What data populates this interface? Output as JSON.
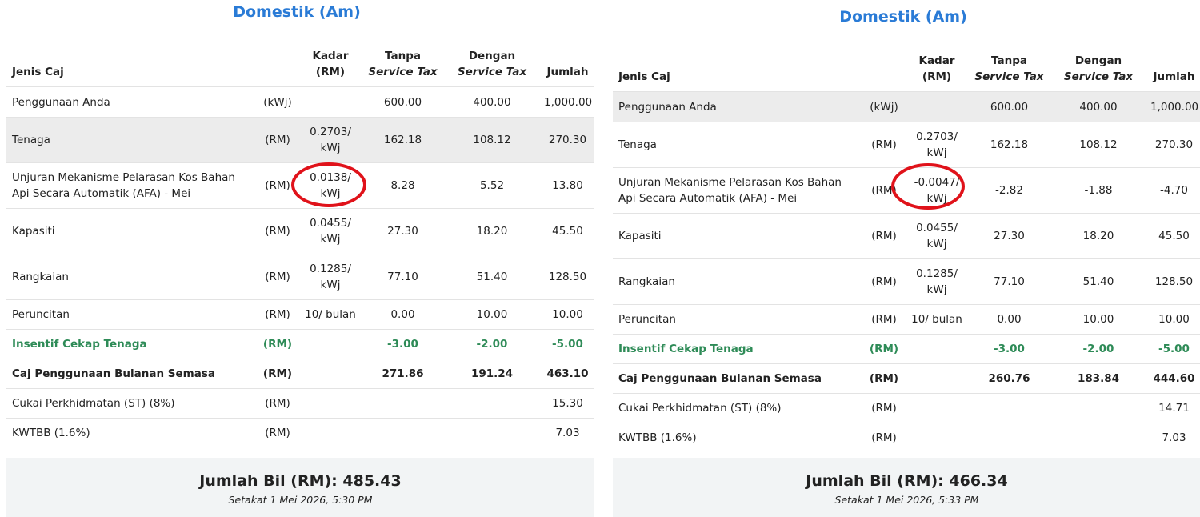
{
  "left": {
    "title": "Domestik (Am)",
    "headers": {
      "name": "Jenis Caj",
      "rate_l1": "Kadar",
      "rate_l2": "(RM)",
      "without_l1": "Tanpa",
      "without_l2": "Service Tax",
      "with_l1": "Dengan",
      "with_l2": "Service Tax",
      "total": "Jumlah"
    },
    "rows": [
      {
        "name": "Penggunaan Anda",
        "unit": "(kWj)",
        "rate": "",
        "without": "600.00",
        "with": "400.00",
        "total": "1,000.00"
      },
      {
        "name": "Tenaga",
        "unit": "(RM)",
        "rate": "0.2703/ kWj",
        "without": "162.18",
        "with": "108.12",
        "total": "270.30"
      },
      {
        "name": "Unjuran Mekanisme Pelarasan Kos Bahan Api Secara Automatik (AFA) - Mei",
        "unit": "(RM)",
        "rate": "0.0138/ kWj",
        "without": "8.28",
        "with": "5.52",
        "total": "13.80"
      },
      {
        "name": "Kapasiti",
        "unit": "(RM)",
        "rate": "0.0455/ kWj",
        "without": "27.30",
        "with": "18.20",
        "total": "45.50"
      },
      {
        "name": "Rangkaian",
        "unit": "(RM)",
        "rate": "0.1285/ kWj",
        "without": "77.10",
        "with": "51.40",
        "total": "128.50"
      },
      {
        "name": "Peruncitan",
        "unit": "(RM)",
        "rate": "10/ bulan",
        "without": "0.00",
        "with": "10.00",
        "total": "10.00"
      },
      {
        "name": "Insentif Cekap Tenaga",
        "unit": "(RM)",
        "rate": "",
        "without": "-3.00",
        "with": "-2.00",
        "total": "-5.00"
      },
      {
        "name": "Caj Penggunaan Bulanan Semasa",
        "unit": "(RM)",
        "rate": "",
        "without": "271.86",
        "with": "191.24",
        "total": "463.10"
      },
      {
        "name": "Cukai Perkhidmatan (ST) (8%)",
        "unit": "(RM)",
        "rate": "",
        "without": "",
        "with": "",
        "total": "15.30"
      },
      {
        "name": "KWTBB (1.6%)",
        "unit": "(RM)",
        "rate": "",
        "without": "",
        "with": "",
        "total": "7.03"
      }
    ],
    "bill_total": "Jumlah Bil (RM): 485.43",
    "timestamp": "Setakat 1 Mei 2026, 5:30 PM"
  },
  "right": {
    "title": "Domestik (Am)",
    "headers": {
      "name": "Jenis Caj",
      "rate_l1": "Kadar",
      "rate_l2": "(RM)",
      "without_l1": "Tanpa",
      "without_l2": "Service Tax",
      "with_l1": "Dengan",
      "with_l2": "Service Tax",
      "total": "Jumlah"
    },
    "rows": [
      {
        "name": "Penggunaan Anda",
        "unit": "(kWj)",
        "rate": "",
        "without": "600.00",
        "with": "400.00",
        "total": "1,000.00"
      },
      {
        "name": "Tenaga",
        "unit": "(RM)",
        "rate": "0.2703/ kWj",
        "without": "162.18",
        "with": "108.12",
        "total": "270.30"
      },
      {
        "name": "Unjuran Mekanisme Pelarasan Kos Bahan Api Secara Automatik (AFA) - Mei",
        "unit": "(RM)",
        "rate": "-0.0047/ kWj",
        "without": "-2.82",
        "with": "-1.88",
        "total": "-4.70"
      },
      {
        "name": "Kapasiti",
        "unit": "(RM)",
        "rate": "0.0455/ kWj",
        "without": "27.30",
        "with": "18.20",
        "total": "45.50"
      },
      {
        "name": "Rangkaian",
        "unit": "(RM)",
        "rate": "0.1285/ kWj",
        "without": "77.10",
        "with": "51.40",
        "total": "128.50"
      },
      {
        "name": "Peruncitan",
        "unit": "(RM)",
        "rate": "10/ bulan",
        "without": "0.00",
        "with": "10.00",
        "total": "10.00"
      },
      {
        "name": "Insentif Cekap Tenaga",
        "unit": "(RM)",
        "rate": "",
        "without": "-3.00",
        "with": "-2.00",
        "total": "-5.00"
      },
      {
        "name": "Caj Penggunaan Bulanan Semasa",
        "unit": "(RM)",
        "rate": "",
        "without": "260.76",
        "with": "183.84",
        "total": "444.60"
      },
      {
        "name": "Cukai Perkhidmatan (ST) (8%)",
        "unit": "(RM)",
        "rate": "",
        "without": "",
        "with": "",
        "total": "14.71"
      },
      {
        "name": "KWTBB (1.6%)",
        "unit": "(RM)",
        "rate": "",
        "without": "",
        "with": "",
        "total": "7.03"
      }
    ],
    "bill_total": "Jumlah Bil (RM): 466.34",
    "timestamp": "Setakat 1 Mei 2026, 5:33 PM"
  },
  "colors": {
    "title": "#2a7bd6",
    "incentive_green": "#2e8b57",
    "highlight_circle": "#e0121a",
    "shaded_row": "#ececec",
    "total_box": "#f2f4f5"
  }
}
